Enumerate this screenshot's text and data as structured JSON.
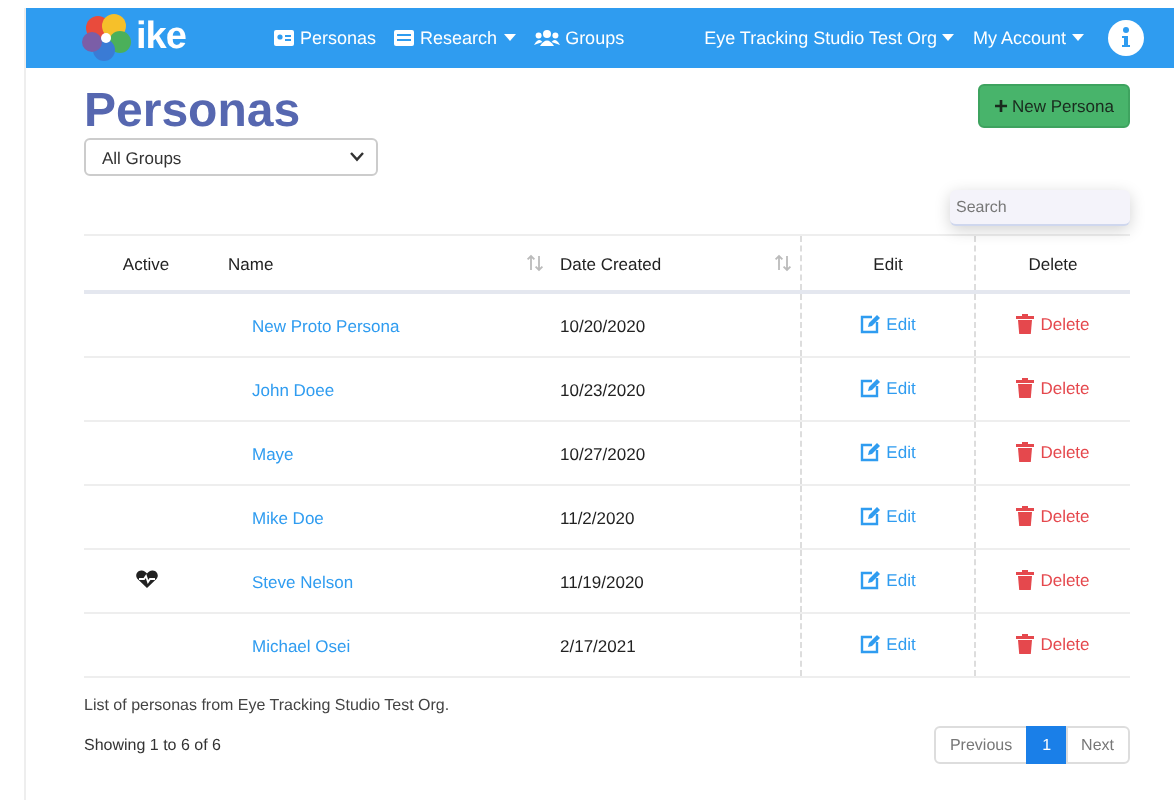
{
  "nav": {
    "logo_text": "ike",
    "links": [
      {
        "label": "Personas",
        "dropdown": false
      },
      {
        "label": "Research",
        "dropdown": true
      },
      {
        "label": "Groups",
        "dropdown": false
      }
    ],
    "right_menus": [
      {
        "label": "Eye Tracking Studio Test Org"
      },
      {
        "label": "My Account"
      }
    ]
  },
  "title": "Personas",
  "new_button": {
    "icon": "+",
    "label": "New Persona"
  },
  "group_filter": {
    "value": "All Groups"
  },
  "search": {
    "placeholder": "Search"
  },
  "table": {
    "columns": [
      {
        "label": "Active",
        "sortable": false
      },
      {
        "label": "Name",
        "sortable": true
      },
      {
        "label": "Date Created",
        "sortable": true
      },
      {
        "label": "Edit",
        "sortable": false
      },
      {
        "label": "Delete",
        "sortable": false
      }
    ],
    "rows": [
      {
        "active": false,
        "name": "New Proto Persona",
        "date": "10/20/2020",
        "edit": "Edit",
        "delete": "Delete"
      },
      {
        "active": false,
        "name": "John Doee",
        "date": "10/23/2020",
        "edit": "Edit",
        "delete": "Delete"
      },
      {
        "active": false,
        "name": "Maye",
        "date": "10/27/2020",
        "edit": "Edit",
        "delete": "Delete"
      },
      {
        "active": false,
        "name": "Mike Doe",
        "date": "11/2/2020",
        "edit": "Edit",
        "delete": "Delete"
      },
      {
        "active": true,
        "name": "Steve Nelson",
        "date": "11/19/2020",
        "edit": "Edit",
        "delete": "Delete"
      },
      {
        "active": false,
        "name": "Michael Osei",
        "date": "2/17/2021",
        "edit": "Edit",
        "delete": "Delete"
      }
    ]
  },
  "caption": "List of personas from Eye Tracking Studio Test Org.",
  "summary": "Showing 1 to 6 of 6",
  "pagination": [
    {
      "label": "Previous",
      "selected": false
    },
    {
      "label": "1",
      "selected": true
    },
    {
      "label": "Next",
      "selected": false
    }
  ]
}
